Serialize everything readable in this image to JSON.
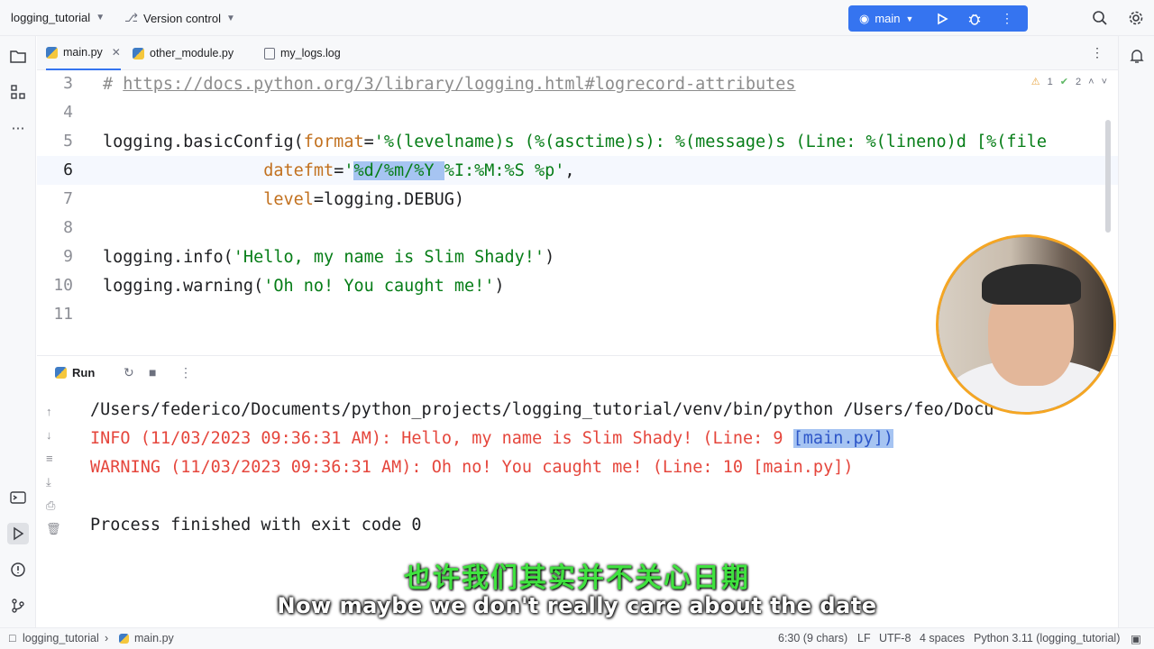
{
  "titlebar": {
    "project": "logging_tutorial",
    "vcs": "Version control",
    "run_config": "main"
  },
  "tabs": [
    {
      "label": "main.py",
      "active": true
    },
    {
      "label": "other_module.py",
      "active": false
    },
    {
      "label": "my_logs.log",
      "active": false
    }
  ],
  "editor": {
    "line_numbers": [
      "3",
      "4",
      "5",
      "6",
      "7",
      "8",
      "9",
      "10",
      "11"
    ],
    "current_line": "6",
    "inspections": {
      "warnings": "1",
      "ok": "2"
    },
    "code": {
      "l3_comment": "# ",
      "l3_url": "https://docs.python.org/3/library/logging.html#logrecord-attributes",
      "l5_fn": "logging.basicConfig(",
      "l5_kw": "format",
      "l5_eq": "=",
      "l5_str": "'%(levelname)s (%(asctime)s): %(message)s (Line: %(lineno)d [%(file",
      "l6_indent": "                ",
      "l6_kw": "datefmt",
      "l6_eq": "=",
      "l6_q": "'",
      "l6_sel": "%d/%m/%Y ",
      "l6_rest": "%I:%M:%S %p'",
      "l6_comma": ",",
      "l7_indent": "                ",
      "l7_kw": "level",
      "l7_rest": "=logging.DEBUG)",
      "l9_fn": "logging.info(",
      "l9_str": "'Hello, my name is Slim Shady!'",
      "l9_end": ")",
      "l10_fn": "logging.warning(",
      "l10_str": "'Oh no! You caught me!'",
      "l10_end": ")"
    }
  },
  "run": {
    "title": "Run",
    "console": {
      "path_line": "/Users/federico/Documents/python_projects/logging_tutorial/venv/bin/python /Users/fe",
      "path_tail": "o/Docu",
      "info_line": "INFO (11/03/2023 09:36:31 AM): Hello, my name is Slim Shady! (Line: 9 ",
      "info_link": "[main.py])",
      "warning_line": "WARNING (11/03/2023 09:36:31 AM): Oh no! You caught me! (Line: 10 [main.py])",
      "exit_line": "Process finished with exit code 0"
    }
  },
  "statusbar": {
    "breadcrumb_project": "logging_tutorial",
    "breadcrumb_file": "main.py",
    "position": "6:30 (9 chars)",
    "line_sep": "LF",
    "encoding": "UTF-8",
    "indent": "4 spaces",
    "interpreter": "Python 3.11 (logging_tutorial)"
  },
  "subtitles": {
    "chinese": "也许我们其实并不关心日期",
    "english": "Now maybe we don't really care about the date"
  },
  "colors": {
    "accent": "#3574f0",
    "error_text": "#e5463c",
    "subtitle_cn": "#3fe23f",
    "webcam_ring": "#f5a623"
  }
}
